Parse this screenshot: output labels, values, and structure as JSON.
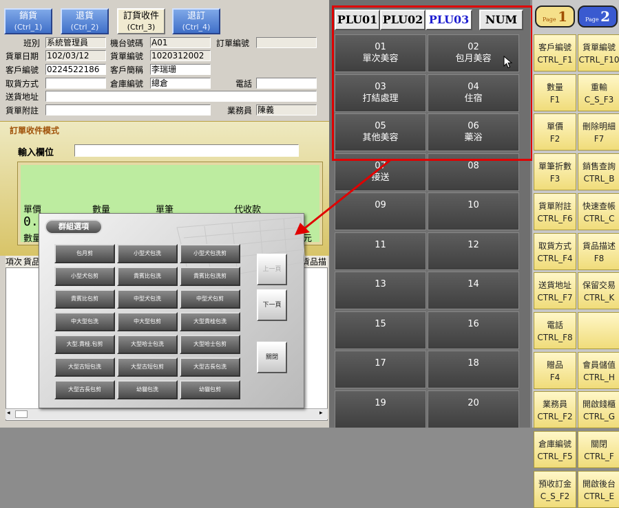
{
  "tabs": [
    {
      "label": "銷貨",
      "shortcut": "(Ctrl_1)"
    },
    {
      "label": "退貨",
      "shortcut": "(Ctrl_2)"
    },
    {
      "label": "訂貨收件",
      "shortcut": "(Ctrl_3)"
    },
    {
      "label": "退訂",
      "shortcut": "(Ctrl_4)"
    }
  ],
  "form": {
    "shift_label": "班別",
    "shift_value": "系統管理員",
    "machine_label": "機台號碼",
    "machine_value": "A01",
    "order_label": "訂單編號",
    "order_value": "",
    "date_label": "貨單日期",
    "date_value": "102/03/12",
    "bill_label": "貨單編號",
    "bill_value": "1020312002",
    "cust_no_label": "客戶編號",
    "cust_no_value": "0224522186",
    "cust_name_label": "客戶簡稱",
    "cust_name_value": "李瑞珊",
    "pickup_label": "取貨方式",
    "pickup_value": "",
    "warehouse_label": "倉庫編號",
    "warehouse_value": "總倉",
    "phone_label": "電話",
    "phone_value": "",
    "address_label": "送貨地址",
    "address_value": "",
    "note_label": "貨單附註",
    "note_value": "",
    "sales_label": "業務員",
    "sales_value": "陳義"
  },
  "order_mode": {
    "title": "訂單收件模式",
    "input_label": "輸入欄位",
    "price_label": "單價",
    "qty_label": "數量",
    "total_label": "單筆",
    "collect_label": "代收款",
    "price_value": "0.0",
    "qty_label2": "數量",
    "yuan": "元"
  },
  "grid_headers": [
    "項次",
    "貨品",
    "貨品描"
  ],
  "popup": {
    "title": "群組選項",
    "buttons": [
      "包月剪",
      "小型犬包洗",
      "小型犬包洗剪",
      "小型犬包剪",
      "貴賓比包洗",
      "貴賓比包洗剪",
      "貴賓比包剪",
      "中型犬包洗",
      "中型犬包剪",
      "中大型包洗",
      "中大型包剪",
      "大型貴桂包洗",
      "大型.貴桂.包剪",
      "大型哈士包洗",
      "大型哈士包剪",
      "大型古短包洗",
      "大型古短包剪",
      "大型古長包洗",
      "大型古長包剪",
      "幼貓包洗",
      "幼貓包剪"
    ],
    "prev": "上一頁",
    "next": "下一頁",
    "close": "關閉"
  },
  "plu_tabs": [
    "PLU01",
    "PLU02",
    "PLU03",
    "NUM"
  ],
  "plu_buttons": [
    {
      "no": "01",
      "name": "單次美容"
    },
    {
      "no": "02",
      "name": "包月美容"
    },
    {
      "no": "03",
      "name": "打結處理"
    },
    {
      "no": "04",
      "name": "住宿"
    },
    {
      "no": "05",
      "name": "其他美容"
    },
    {
      "no": "06",
      "name": "藥浴"
    },
    {
      "no": "07",
      "name": "接送"
    },
    {
      "no": "08",
      "name": ""
    },
    {
      "no": "09",
      "name": ""
    },
    {
      "no": "10",
      "name": ""
    },
    {
      "no": "11",
      "name": ""
    },
    {
      "no": "12",
      "name": ""
    },
    {
      "no": "13",
      "name": ""
    },
    {
      "no": "14",
      "name": ""
    },
    {
      "no": "15",
      "name": ""
    },
    {
      "no": "16",
      "name": ""
    },
    {
      "no": "17",
      "name": ""
    },
    {
      "no": "18",
      "name": ""
    },
    {
      "no": "19",
      "name": ""
    },
    {
      "no": "20",
      "name": ""
    }
  ],
  "pages": [
    {
      "word": "Page",
      "num": "1"
    },
    {
      "word": "Page",
      "num": "2"
    }
  ],
  "fn_keys": [
    {
      "label": "客戶編號",
      "key": "CTRL_F1"
    },
    {
      "label": "貨單編號",
      "key": "CTRL_F10"
    },
    {
      "label": "數量",
      "key": "F1"
    },
    {
      "label": "重輸",
      "key": "C_S_F3"
    },
    {
      "label": "單價",
      "key": "F2"
    },
    {
      "label": "刪除明細",
      "key": "F7"
    },
    {
      "label": "單筆折數",
      "key": "F3"
    },
    {
      "label": "銷售查詢",
      "key": "CTRL_B"
    },
    {
      "label": "貨單附註",
      "key": "CTRL_F6"
    },
    {
      "label": "快速查帳",
      "key": "CTRL_C"
    },
    {
      "label": "取貨方式",
      "key": "CTRL_F4"
    },
    {
      "label": "貨品描述",
      "key": "F8"
    },
    {
      "label": "送貨地址",
      "key": "CTRL_F7"
    },
    {
      "label": "保留交易",
      "key": "CTRL_K"
    },
    {
      "label": "電話",
      "key": "CTRL_F8"
    },
    {
      "label": "",
      "key": ""
    },
    {
      "label": "贈品",
      "key": "F4"
    },
    {
      "label": "會員儲值",
      "key": "CTRL_H"
    },
    {
      "label": "業務員",
      "key": "CTRL_F2"
    },
    {
      "label": "開啟錢櫃",
      "key": "CTRL_G"
    },
    {
      "label": "倉庫編號",
      "key": "CTRL_F5"
    },
    {
      "label": "關閉",
      "key": "CTRL_F"
    },
    {
      "label": "預收訂金",
      "key": "C_S_F2"
    },
    {
      "label": "開啟後台",
      "key": "CTRL_E"
    }
  ],
  "colors": {
    "highlight": "#e00000",
    "plu_active": "#2020d0",
    "fn_key": "#f0dc7a",
    "order_panel": "#d8c468",
    "total_panel": "#bdeca0"
  }
}
